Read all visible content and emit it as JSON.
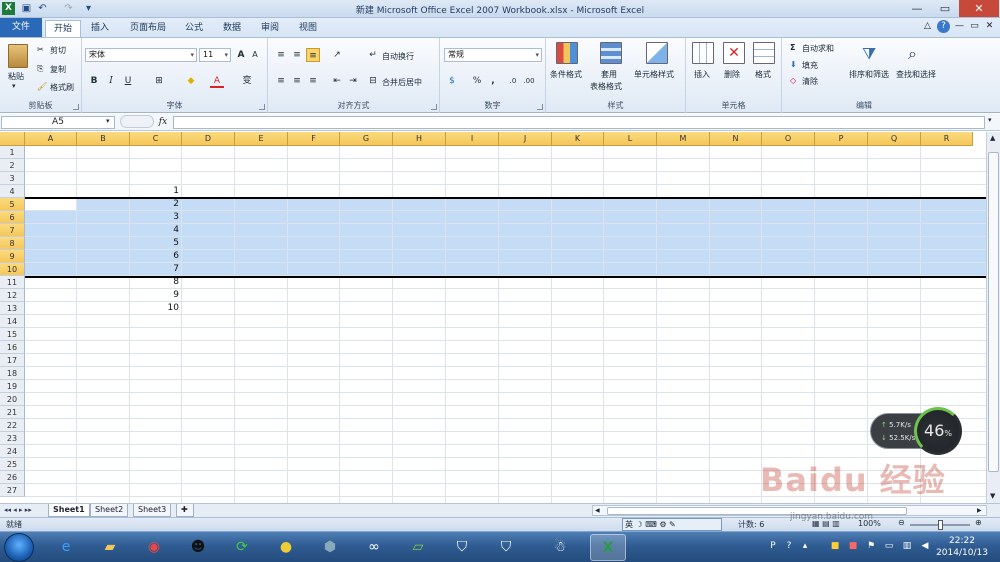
{
  "titlebar": {
    "title": "新建 Microsoft Office Excel 2007 Workbook.xlsx  -  Microsoft Excel"
  },
  "tabs": [
    "文件",
    "开始",
    "插入",
    "页面布局",
    "公式",
    "数据",
    "审阅",
    "视图"
  ],
  "ribbon": {
    "clipboard": {
      "paste": "粘贴",
      "cut": "剪切",
      "copy": "复制",
      "format_painter": "格式刷",
      "label": "剪贴板"
    },
    "font": {
      "name": "宋体",
      "size": "11",
      "bold": "B",
      "italic": "I",
      "underline": "U",
      "label": "字体",
      "wen": "变"
    },
    "alignment": {
      "wrap": "自动换行",
      "merge": "合并后居中",
      "label": "对齐方式"
    },
    "number": {
      "format": "常规",
      "percent": "%",
      "comma": ",",
      "label": "数字"
    },
    "styles": {
      "conditional": "条件格式",
      "table_format_1": "套用",
      "table_format_2": "表格格式",
      "cell_styles": "单元格样式",
      "label": "样式"
    },
    "cells": {
      "insert": "插入",
      "delete": "删除",
      "format": "格式",
      "label": "单元格"
    },
    "editing": {
      "autosum": "自动求和",
      "fill": "填充",
      "clear": "清除",
      "sort": "排序和筛选",
      "find": "查找和选择",
      "label": "编辑"
    }
  },
  "formula_bar": {
    "name_box": "A5",
    "fx": "fx",
    "value": ""
  },
  "columns": [
    "A",
    "B",
    "C",
    "D",
    "E",
    "F",
    "G",
    "H",
    "I",
    "J",
    "K",
    "L",
    "M",
    "N",
    "O",
    "P",
    "Q",
    "R"
  ],
  "rows": [
    "1",
    "2",
    "3",
    "4",
    "5",
    "6",
    "7",
    "8",
    "9",
    "10",
    "11",
    "12",
    "13",
    "14",
    "15",
    "16",
    "17",
    "18",
    "19",
    "20",
    "21",
    "22",
    "23",
    "24",
    "25",
    "26",
    "27"
  ],
  "selected_rows": [
    "5",
    "6",
    "7",
    "8",
    "9",
    "10"
  ],
  "cells_C": {
    "row4": "1",
    "row5": "2",
    "row6": "3",
    "row7": "4",
    "row8": "5",
    "row9": "6",
    "row10": "7",
    "row11": "8",
    "row12": "9",
    "row13": "10"
  },
  "sheets": [
    "Sheet1",
    "Sheet2",
    "Sheet3"
  ],
  "statusbar": {
    "text": "就绪",
    "ime": "英 ☽ ⌨ ⚙ ✎",
    "count": "计数: 6",
    "zoom": "100%"
  },
  "taskbar": {
    "time": "22:22",
    "date": "2014/10/13"
  },
  "widget": {
    "up": "5.7K/s",
    "down": "52.5K/s",
    "percent": "46",
    "unit": "%"
  },
  "watermark": {
    "text": "Baidu 经验",
    "sub": "jingyan.baidu.com"
  }
}
